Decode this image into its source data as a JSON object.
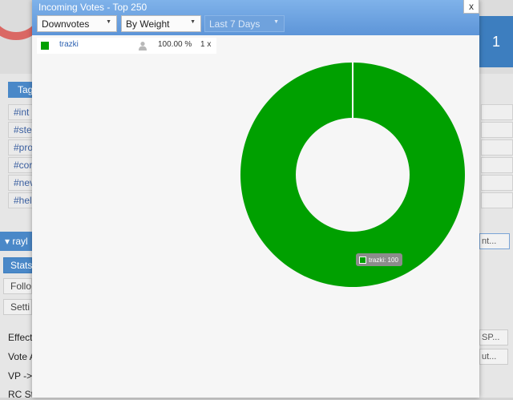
{
  "modal": {
    "title": "Incoming Votes - Top 250",
    "close_label": "x",
    "filters": {
      "vote_type": "Downvotes",
      "sort": "By Weight",
      "period": "Last 7 Days"
    }
  },
  "legend": [
    {
      "name": "trazki",
      "percent": "100.00 %",
      "count": "1 x",
      "color": "#00a000"
    }
  ],
  "tooltip": {
    "text": "trazki: 100"
  },
  "chart_data": {
    "type": "pie",
    "donut": true,
    "categories": [
      "trazki"
    ],
    "values": [
      100
    ],
    "colors": [
      "#00a000"
    ]
  },
  "background_page": {
    "badge_number": "1",
    "tags_header": "Tag",
    "tags": [
      "#int",
      "#ste",
      "#pro",
      "#cor",
      "#nev",
      "#hel"
    ],
    "user_name": "rayl",
    "right_button": "nt...",
    "side_tabs": [
      "Stats",
      "Follo",
      "Setti"
    ],
    "labels": [
      "Effect",
      "Vote A",
      "VP ->",
      "RC Sta"
    ],
    "right_small": [
      "SP...",
      "ut..."
    ]
  }
}
